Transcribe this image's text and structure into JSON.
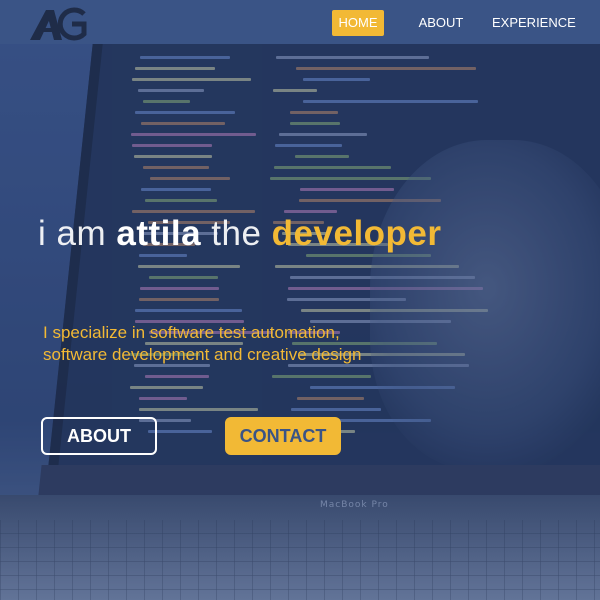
{
  "nav": {
    "logo_text": "AG",
    "items": [
      {
        "label": "HOME",
        "active": true
      },
      {
        "label": "ABOUT",
        "active": false
      },
      {
        "label": "EXPERIENCE",
        "active": false
      }
    ]
  },
  "hero": {
    "headline": {
      "part1": "i am ",
      "name": "attila",
      "part2": " the ",
      "role": "developer"
    },
    "tagline_line1": "I specialize in software test automation,",
    "tagline_line2": "software development and creative design",
    "buttons": {
      "about": "ABOUT",
      "contact": "CONTACT"
    },
    "device_brand": "MacBook Pro"
  },
  "colors": {
    "accent": "#f2b935",
    "nav_bg": "#3a5486",
    "text": "#ffffff"
  }
}
